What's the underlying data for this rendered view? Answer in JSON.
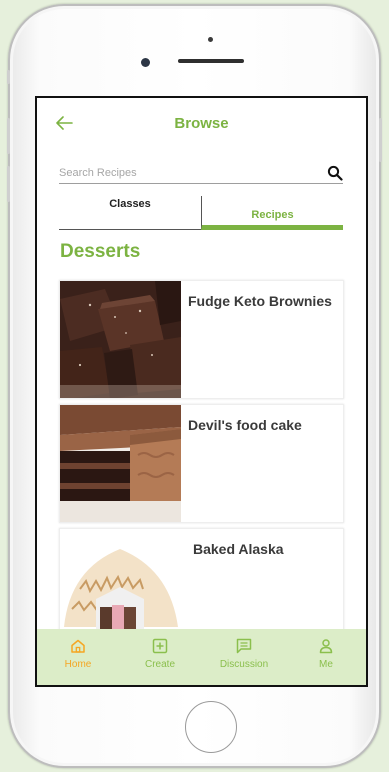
{
  "app": {
    "header": {
      "title": "Browse",
      "back_icon": "back-arrow-icon"
    },
    "search": {
      "placeholder": "Search Recipes",
      "value": "",
      "icon": "search-icon"
    },
    "tabs": [
      {
        "label": "Classes",
        "active": false
      },
      {
        "label": "Recipes",
        "active": true
      }
    ],
    "section_title": "Desserts",
    "recipes": [
      {
        "title": "Fudge Keto Brownies",
        "image": "brownies-photo"
      },
      {
        "title": "Devil's food cake",
        "image": "chocolate-cake-photo"
      },
      {
        "title": "Baked Alaska",
        "image": "baked-alaska-photo"
      }
    ],
    "bottom_nav": [
      {
        "label": "Home",
        "icon": "home-icon",
        "active": true
      },
      {
        "label": "Create",
        "icon": "add-square-icon",
        "active": false
      },
      {
        "label": "Discussion",
        "icon": "chat-icon",
        "active": false
      },
      {
        "label": "Me",
        "icon": "person-icon",
        "active": false
      }
    ]
  },
  "colors": {
    "accent": "#7cb342",
    "nav_background": "#dcedc8",
    "nav_active": "#f5a623",
    "page_background": "#e6f0dc"
  }
}
